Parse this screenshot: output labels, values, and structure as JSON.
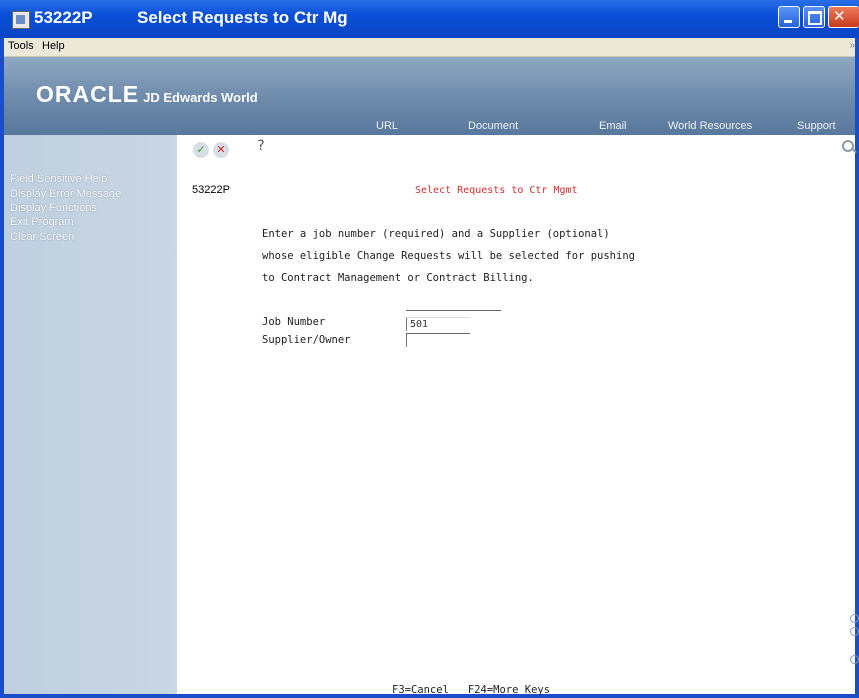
{
  "titlebar": {
    "program_id": "53222P",
    "title": "Select Requests to Ctr Mg"
  },
  "menubar": {
    "items": [
      "Tools",
      "Help"
    ]
  },
  "header": {
    "brand": "ORACLE",
    "product": "JD Edwards World",
    "nav": [
      "URL",
      "Document",
      "Email",
      "World Resources",
      "Support"
    ]
  },
  "sidebar": {
    "items": [
      "Field Sensitive Help",
      "Display Error Message",
      "Display Functions",
      "Exit Program",
      "Clear Screen"
    ]
  },
  "toolbar": {
    "ok_icon": "✓",
    "cancel_icon": "✕",
    "help_icon": "?"
  },
  "screen": {
    "program_id": "53222P",
    "title": "Select Requests to Ctr Mgmt",
    "instructions": [
      "Enter a job number (required) and a Supplier (optional)",
      "whose eligible Change Requests will be selected for pushing",
      "to Contract Management or Contract Billing."
    ],
    "fields": {
      "job_number_label": "Job Number",
      "job_number_value": "501",
      "supplier_label": "Supplier/Owner",
      "supplier_value": ""
    },
    "function_keys": "F3=Cancel   F24=More Keys"
  }
}
